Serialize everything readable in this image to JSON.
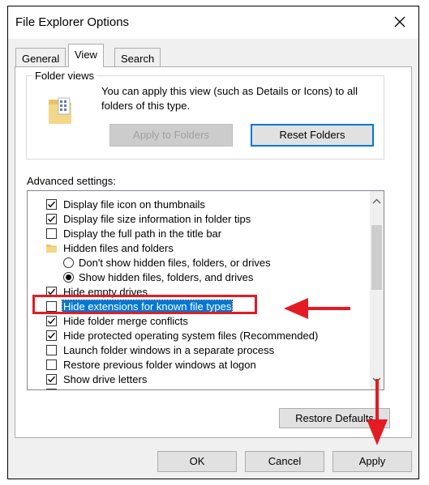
{
  "window": {
    "title": "File Explorer Options"
  },
  "tabs": [
    {
      "label": "General",
      "active": false
    },
    {
      "label": "View",
      "active": true
    },
    {
      "label": "Search",
      "active": false
    }
  ],
  "folder_views": {
    "group_label": "Folder views",
    "description": "You can apply this view (such as Details or Icons) to all folders of this type.",
    "apply_button": "Apply to Folders",
    "reset_button": "Reset Folders"
  },
  "advanced": {
    "label": "Advanced settings:",
    "items": [
      {
        "type": "checkbox",
        "checked": true,
        "label": "Display file icon on thumbnails"
      },
      {
        "type": "checkbox",
        "checked": true,
        "label": "Display file size information in folder tips"
      },
      {
        "type": "checkbox",
        "checked": false,
        "label": "Display the full path in the title bar"
      },
      {
        "type": "folder",
        "label": "Hidden files and folders"
      },
      {
        "type": "radio",
        "checked": false,
        "label": "Don't show hidden files, folders, or drives"
      },
      {
        "type": "radio",
        "checked": true,
        "label": "Show hidden files, folders, and drives"
      },
      {
        "type": "checkbox",
        "checked": true,
        "label": "Hide empty drives"
      },
      {
        "type": "checkbox",
        "checked": false,
        "label": "Hide extensions for known file types",
        "selected": true
      },
      {
        "type": "checkbox",
        "checked": true,
        "label": "Hide folder merge conflicts"
      },
      {
        "type": "checkbox",
        "checked": true,
        "label": "Hide protected operating system files (Recommended)"
      },
      {
        "type": "checkbox",
        "checked": false,
        "label": "Launch folder windows in a separate process"
      },
      {
        "type": "checkbox",
        "checked": false,
        "label": "Restore previous folder windows at logon"
      },
      {
        "type": "checkbox",
        "checked": true,
        "label": "Show drive letters"
      }
    ],
    "restore_defaults": "Restore Defaults"
  },
  "footer": {
    "ok": "OK",
    "cancel": "Cancel",
    "apply": "Apply"
  },
  "colors": {
    "annotation": "#e31b23",
    "selection": "#0078d7",
    "focus": "#0078d7"
  }
}
